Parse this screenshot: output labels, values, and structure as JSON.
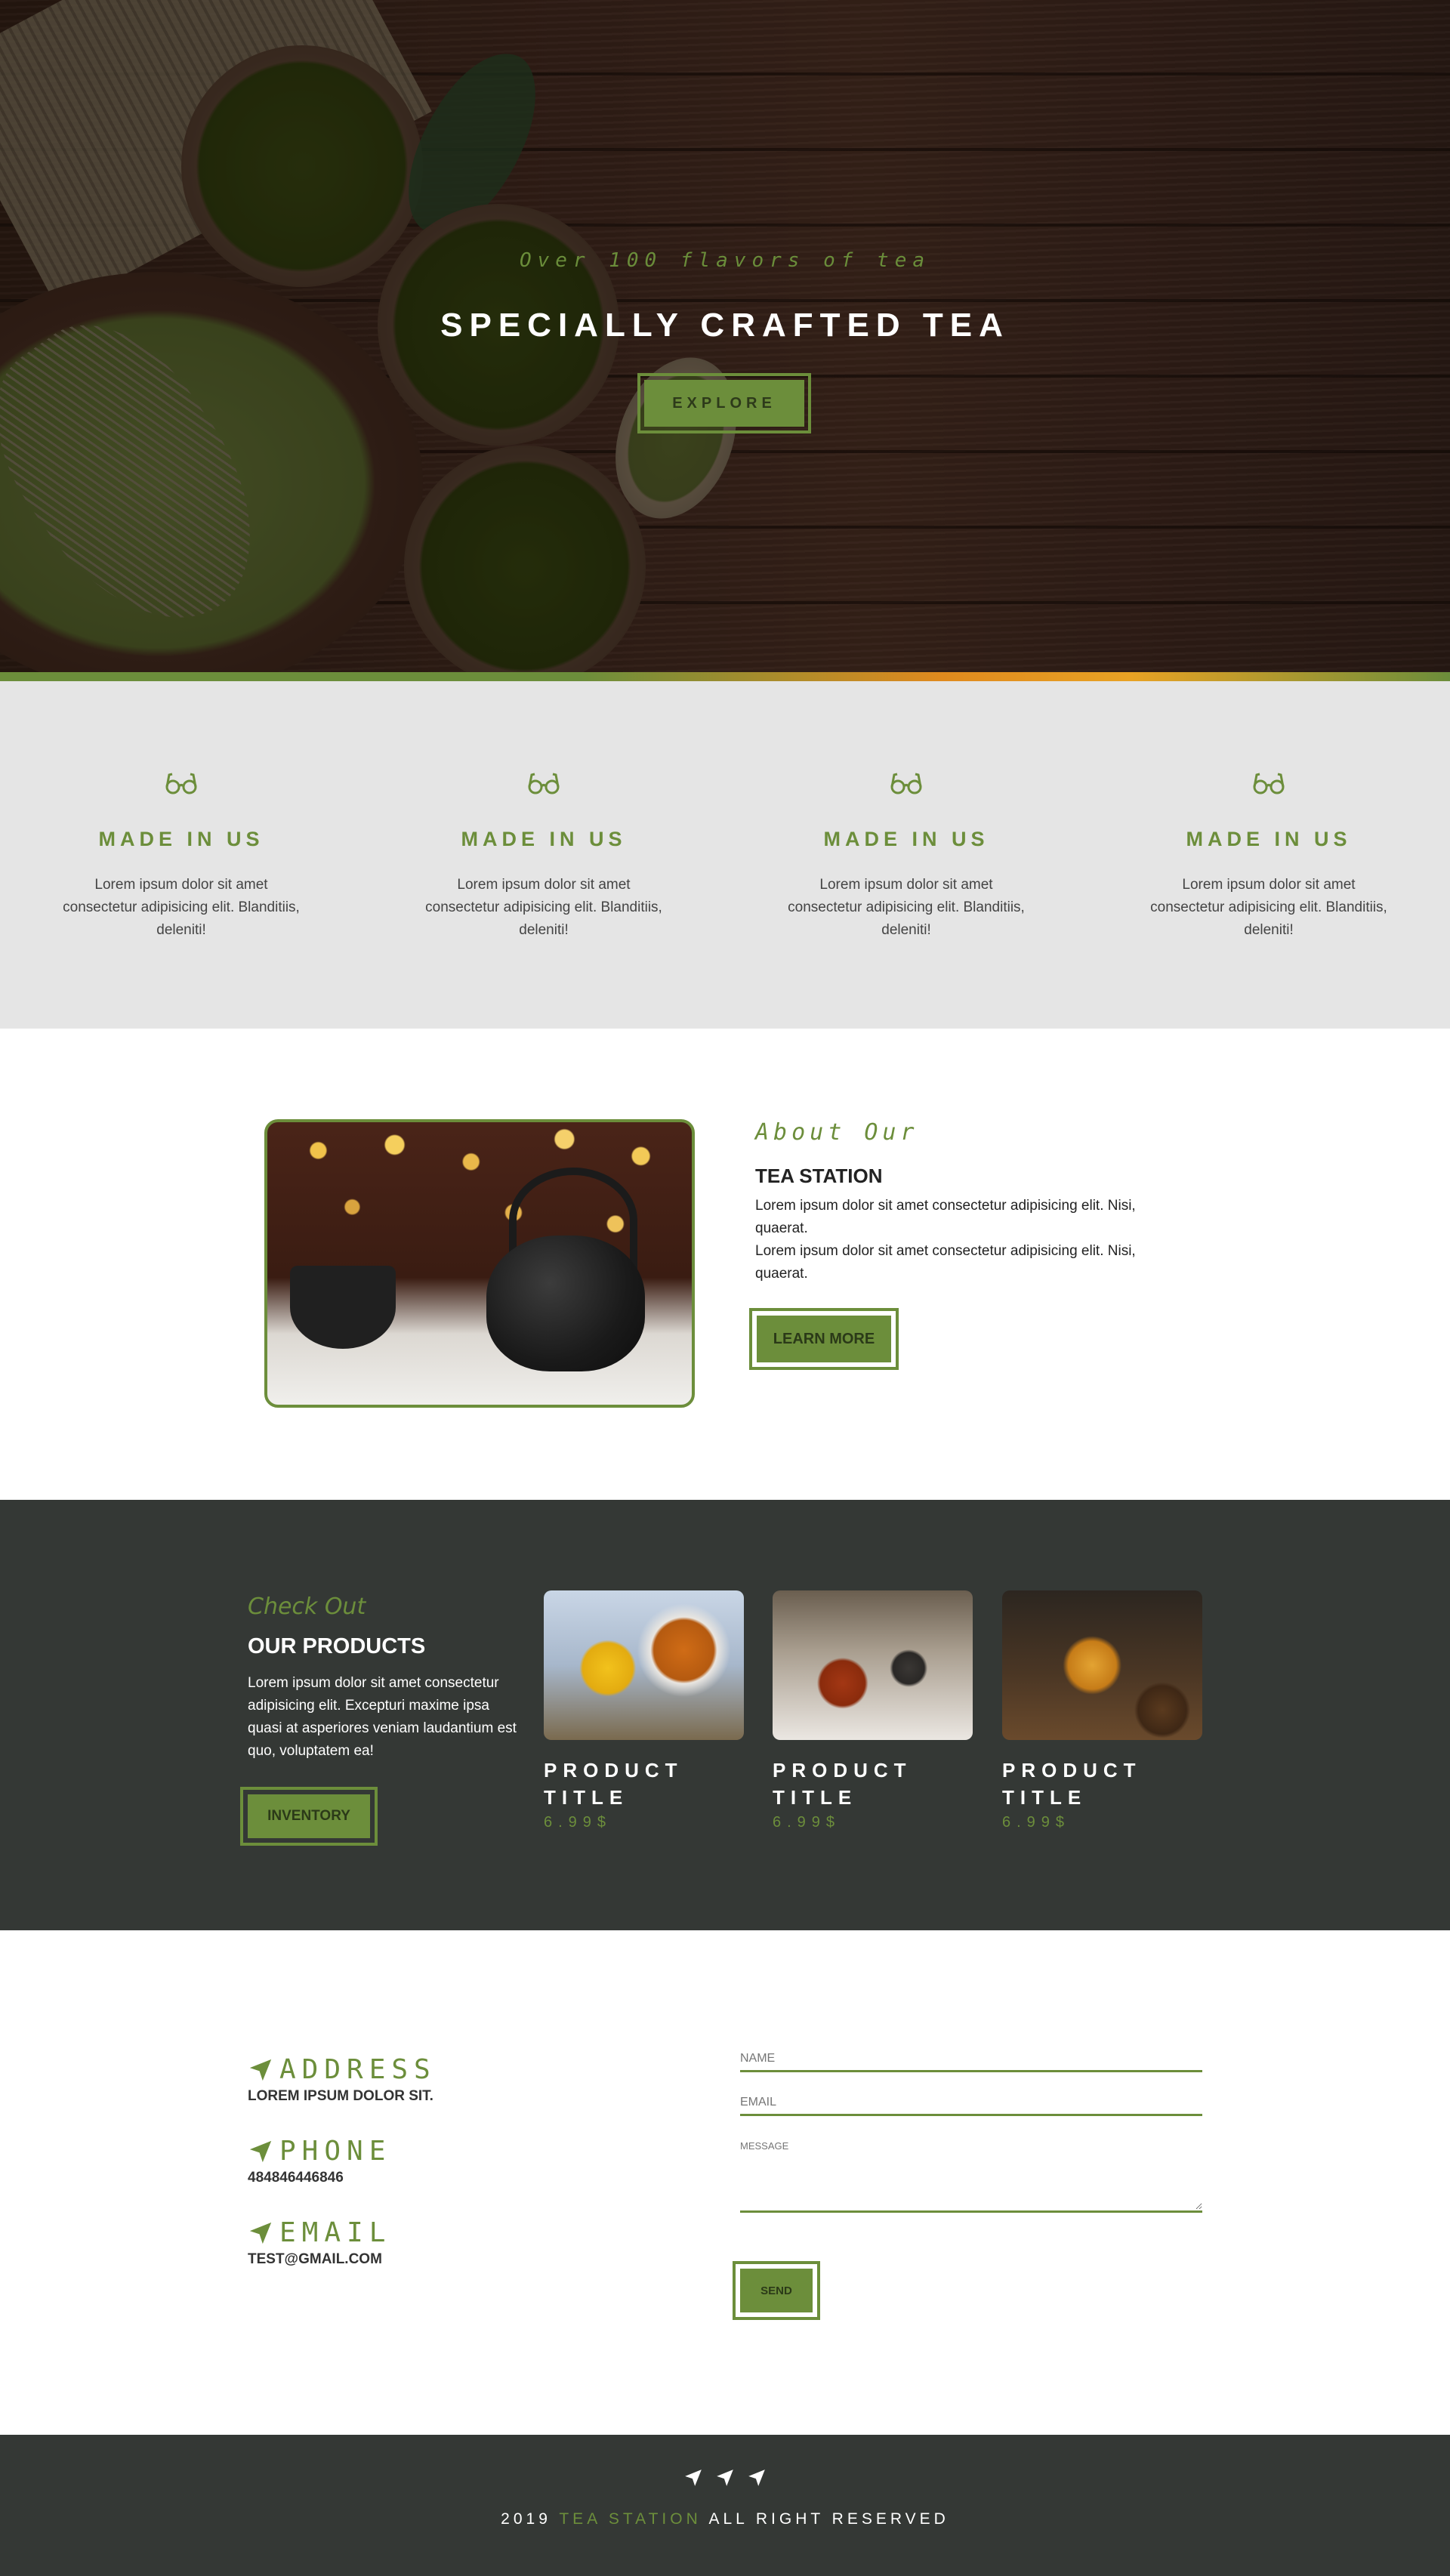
{
  "hero": {
    "subtitle": "Over 100 flavors of tea",
    "title": "SPECIALLY CRAFTED TEA",
    "button": "EXPLORE"
  },
  "features": [
    {
      "icon": "glasses-icon",
      "title": "MADE IN US",
      "text": "Lorem ipsum dolor sit amet consectetur adipisicing elit. Blanditiis, deleniti!"
    },
    {
      "icon": "glasses-icon",
      "title": "MADE IN US",
      "text": "Lorem ipsum dolor sit amet consectetur adipisicing elit. Blanditiis, deleniti!"
    },
    {
      "icon": "glasses-icon",
      "title": "MADE IN US",
      "text": "Lorem ipsum dolor sit amet consectetur adipisicing elit. Blanditiis, deleniti!"
    },
    {
      "icon": "glasses-icon",
      "title": "MADE IN US",
      "text": "Lorem ipsum dolor sit amet consectetur adipisicing elit. Blanditiis, deleniti!"
    }
  ],
  "about": {
    "title": "About Our",
    "subtitle": "TEA STATION",
    "paragraph1": "Lorem ipsum dolor sit amet consectetur adipisicing elit. Nisi, quaerat.",
    "paragraph2": "Lorem ipsum dolor sit amet consectetur adipisicing elit. Nisi, quaerat.",
    "button": "LEARN MORE"
  },
  "products": {
    "kicker": "Check Out",
    "heading": "OUR PRODUCTS",
    "text": "Lorem ipsum dolor sit amet consectetur adipisicing elit. Excepturi maxime ipsa quasi at asperiores veniam laudantium est quo, voluptatem ea!",
    "button": "INVENTORY",
    "items": [
      {
        "title": "PRODUCT TITLE",
        "price": "6.99$"
      },
      {
        "title": "PRODUCT TITLE",
        "price": "6.99$"
      },
      {
        "title": "PRODUCT TITLE",
        "price": "6.99$"
      }
    ]
  },
  "contact": {
    "address_label": "ADDRESS",
    "address_value": "LOREM IPSUM DOLOR SIT.",
    "phone_label": "PHONE",
    "phone_value": "484846446846",
    "email_label": "EMAIL",
    "email_value": "TEST@GMAIL.COM",
    "name_placeholder": "NAME",
    "email_placeholder": "EMAIL",
    "message_placeholder": "MESSAGE",
    "send": "SEND"
  },
  "footer": {
    "year": "2019",
    "brand": "TEA STATION",
    "rights": "ALL RIGHT RESERVED"
  },
  "colors": {
    "accent": "#6c8e3b",
    "dark": "#343835",
    "light_gray": "#e5e5e5"
  }
}
